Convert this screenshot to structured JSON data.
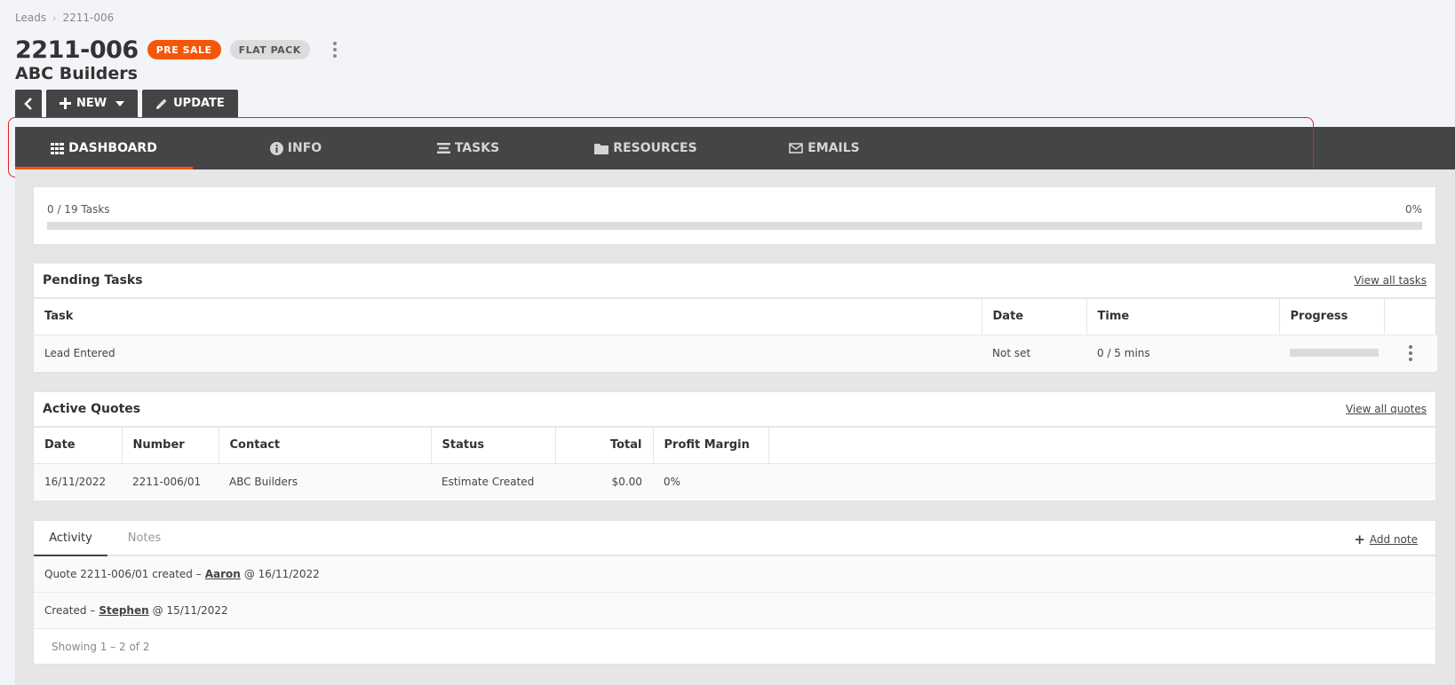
{
  "breadcrumb": {
    "root": "Leads",
    "separator": "›",
    "current": "2211-006"
  },
  "header": {
    "title": "2211-006",
    "badges": {
      "status": "PRE SALE",
      "type": "FLAT PACK"
    },
    "subtitle": "ABC Builders"
  },
  "toolbar": {
    "new_label": "NEW",
    "update_label": "UPDATE"
  },
  "nav": {
    "tabs": [
      {
        "label": "DASHBOARD",
        "icon": "grid-icon",
        "active": true
      },
      {
        "label": "INFO",
        "icon": "info-icon",
        "active": false
      },
      {
        "label": "TASKS",
        "icon": "list-icon",
        "active": false
      },
      {
        "label": "RESOURCES",
        "icon": "folder-icon",
        "active": false
      },
      {
        "label": "EMAILS",
        "icon": "envelope-icon",
        "active": false
      }
    ]
  },
  "progress": {
    "text": "0 / 19 Tasks",
    "percent_text": "0%",
    "fraction": 0
  },
  "pending": {
    "title": "Pending Tasks",
    "link": "View all tasks",
    "columns": [
      "Task",
      "Date",
      "Time",
      "Progress"
    ],
    "rows": [
      {
        "task": "Lead Entered",
        "date": "Not set",
        "time": "0 / 5 mins",
        "progress": 0
      }
    ]
  },
  "quotes": {
    "title": "Active Quotes",
    "link": "View all quotes",
    "columns": [
      "Date",
      "Number",
      "Contact",
      "Status",
      "Total",
      "Profit Margin"
    ],
    "rows": [
      {
        "date": "16/11/2022",
        "number": "2211-006/01",
        "contact": "ABC Builders",
        "status": "Estimate Created",
        "total": "$0.00",
        "margin": "0%"
      }
    ]
  },
  "activity": {
    "tabs": [
      "Activity",
      "Notes"
    ],
    "add_note": "Add note",
    "items": [
      {
        "prefix": "Quote 2211-006/01 created –",
        "user": "Aaron",
        "suffix": "@ 16/11/2022"
      },
      {
        "prefix": "Created –",
        "user": "Stephen",
        "suffix": "@ 15/11/2022"
      }
    ],
    "footer": "Showing 1 – 2 of 2"
  },
  "colors": {
    "accent": "#f5560a",
    "nav_bg": "#454545",
    "highlight": "#e02020"
  }
}
